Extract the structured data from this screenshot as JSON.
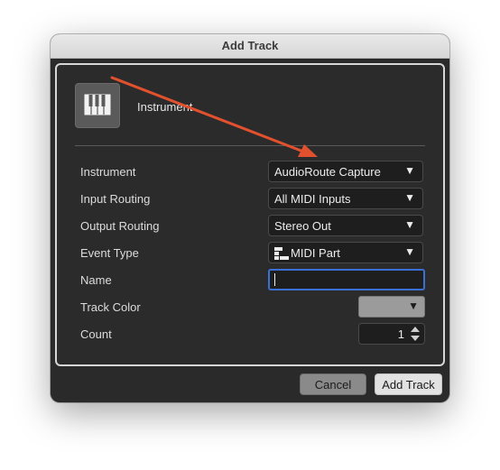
{
  "window": {
    "title": "Add Track"
  },
  "track_type": {
    "label": "Instrument",
    "icon": "piano-keys-icon"
  },
  "fields": {
    "instrument": {
      "label": "Instrument",
      "value": "AudioRoute Capture"
    },
    "input_routing": {
      "label": "Input Routing",
      "value": "All MIDI Inputs"
    },
    "output_routing": {
      "label": "Output Routing",
      "value": "Stereo Out"
    },
    "event_type": {
      "label": "Event Type",
      "value": "MIDI Part",
      "icon": "midi-part-icon"
    },
    "name": {
      "label": "Name",
      "value": ""
    },
    "track_color": {
      "label": "Track Color",
      "color": "#9b9b9b"
    },
    "count": {
      "label": "Count",
      "value": "1"
    }
  },
  "buttons": {
    "cancel": "Cancel",
    "add_track": "Add Track"
  },
  "colors": {
    "dialog_bg": "#2a2a2a",
    "focus_ring": "#3a6fd6",
    "annotation_arrow": "#e2512e"
  }
}
